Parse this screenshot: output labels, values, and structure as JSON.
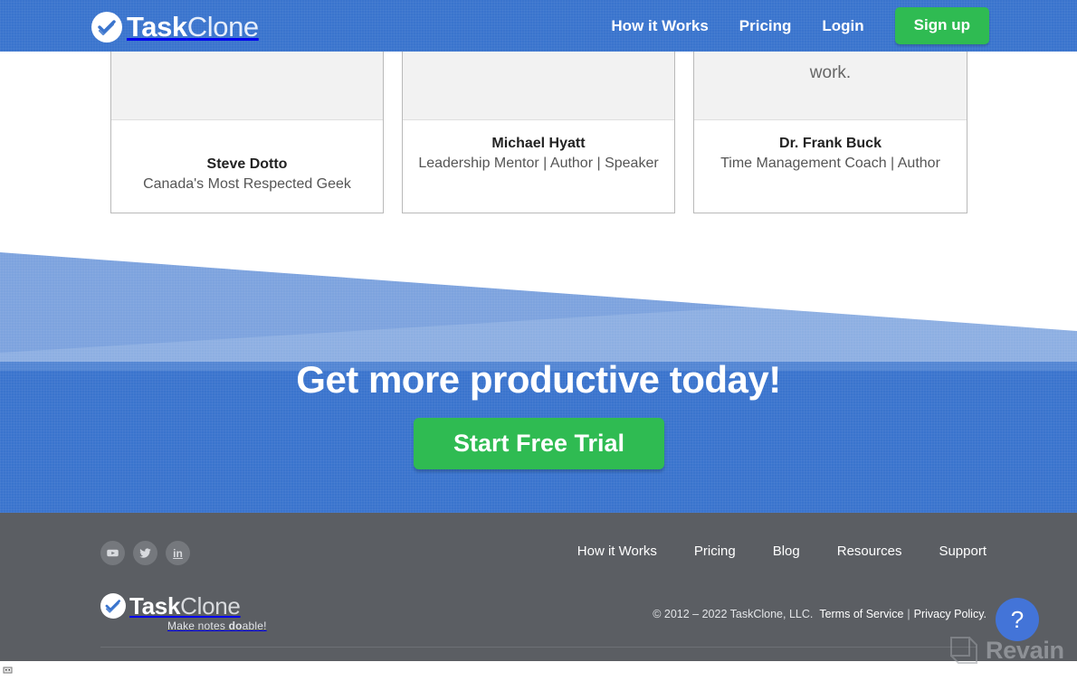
{
  "header": {
    "logo": {
      "part1": "Task",
      "part2": "Clone",
      "icon": "checkmark-badge-icon"
    },
    "nav": [
      {
        "label": "How it Works",
        "name": "nav-how-it-works"
      },
      {
        "label": "Pricing",
        "name": "nav-pricing"
      },
      {
        "label": "Login",
        "name": "nav-login"
      }
    ],
    "signup_label": "Sign up",
    "bg_color": "#3a74cd",
    "signup_color": "#2fbb52"
  },
  "testimonials": [
    {
      "quote": "",
      "name": "Steve Dotto",
      "role": "Canada's Most Respected Geek"
    },
    {
      "quote": "",
      "name": "Michael Hyatt",
      "role": "Leadership Mentor | Author | Speaker"
    },
    {
      "quote": "work.",
      "name": "Dr. Frank Buck",
      "role": "Time Management Coach | Author"
    }
  ],
  "cta": {
    "title": "Get more productive today!",
    "button_label": "Start Free Trial",
    "bg_color": "#3a74cd",
    "button_color": "#2fbb52"
  },
  "footer": {
    "social": [
      {
        "name": "youtube-icon",
        "label": "YouTube"
      },
      {
        "name": "twitter-icon",
        "label": "Twitter"
      },
      {
        "name": "linkedin-icon",
        "label": "in"
      }
    ],
    "logo": {
      "part1": "Task",
      "part2": "Clone"
    },
    "tagline_pre": "Make notes ",
    "tagline_bold": "do",
    "tagline_post": "able!",
    "nav": [
      {
        "label": "How it Works",
        "name": "footer-nav-how-it-works"
      },
      {
        "label": "Pricing",
        "name": "footer-nav-pricing"
      },
      {
        "label": "Blog",
        "name": "footer-nav-blog"
      },
      {
        "label": "Resources",
        "name": "footer-nav-resources"
      },
      {
        "label": "Support",
        "name": "footer-nav-support"
      }
    ],
    "copyright": "© 2012 – 2022 TaskClone, LLC.",
    "terms_label": "Terms of Service",
    "separator": "|",
    "privacy_label": "Privacy Policy.",
    "bg_color": "#5b5e63"
  },
  "overlays": {
    "help_label": "?",
    "help_color": "#4374d8",
    "watermark_text": "Revain"
  }
}
